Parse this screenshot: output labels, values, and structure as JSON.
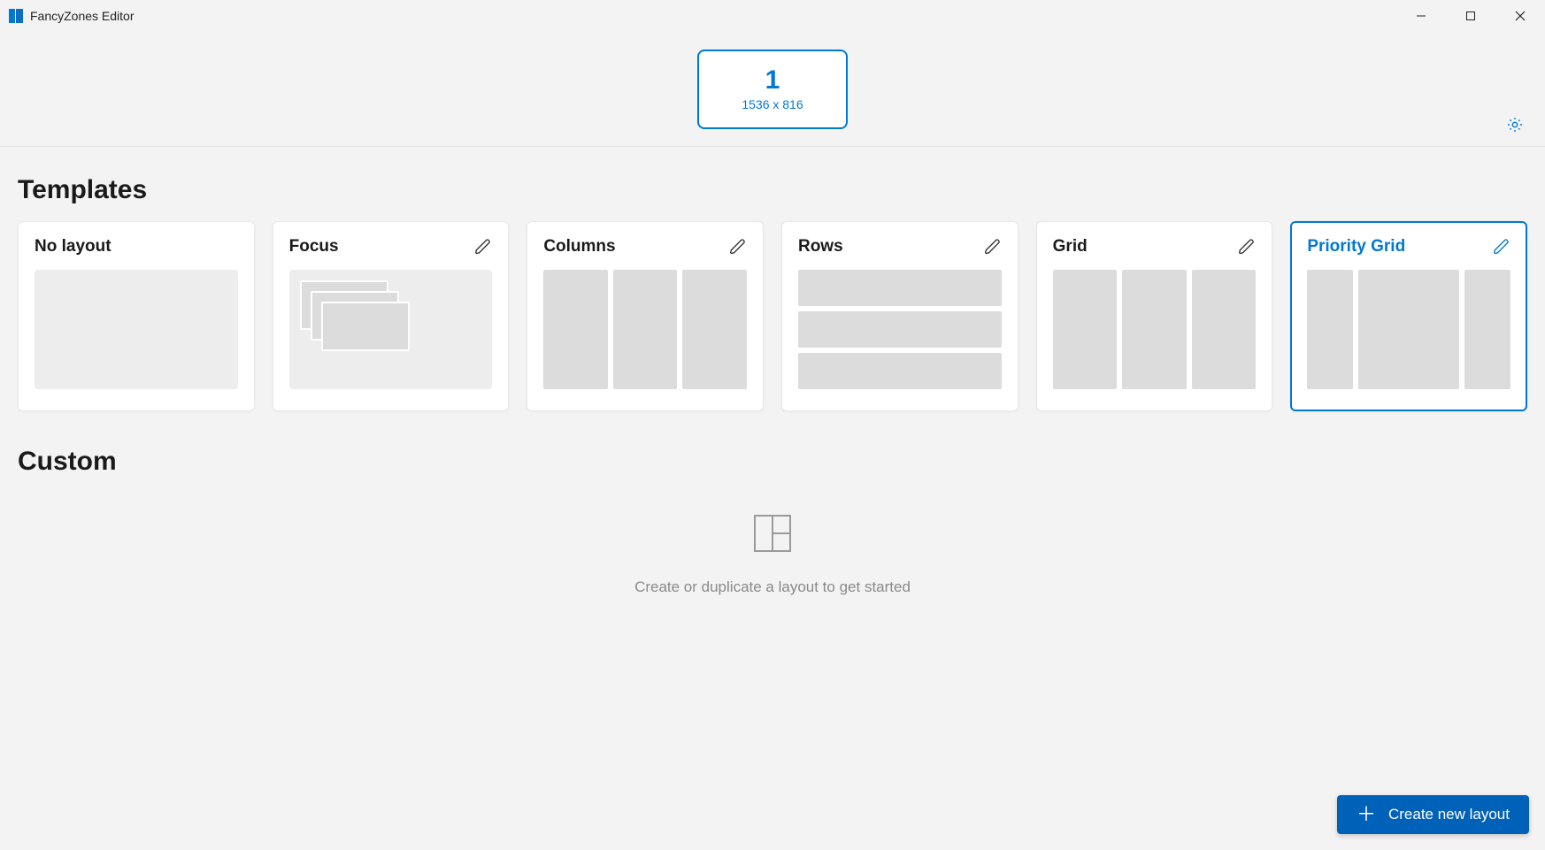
{
  "window": {
    "title": "FancyZones Editor"
  },
  "monitor": {
    "index": "1",
    "resolution": "1536 x 816"
  },
  "sections": {
    "templates_heading": "Templates",
    "custom_heading": "Custom"
  },
  "templates": [
    {
      "name": "No layout",
      "editable": false,
      "selected": false
    },
    {
      "name": "Focus",
      "editable": true,
      "selected": false
    },
    {
      "name": "Columns",
      "editable": true,
      "selected": false
    },
    {
      "name": "Rows",
      "editable": true,
      "selected": false
    },
    {
      "name": "Grid",
      "editable": true,
      "selected": false
    },
    {
      "name": "Priority Grid",
      "editable": true,
      "selected": true
    }
  ],
  "custom": {
    "empty_message": "Create or duplicate a layout to get started"
  },
  "actions": {
    "create_new_layout": "Create new layout"
  }
}
